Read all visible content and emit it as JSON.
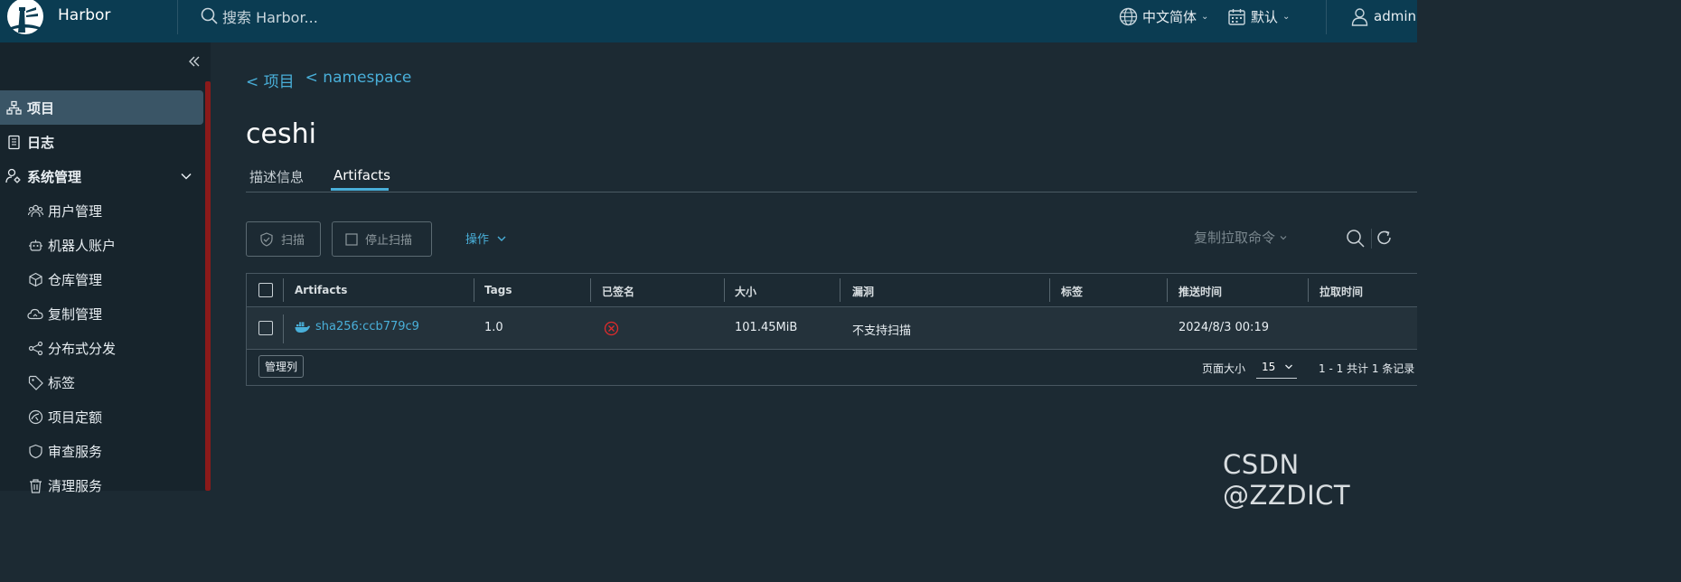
{
  "header": {
    "brand": "Harbor",
    "search_placeholder": "搜索 Harbor...",
    "language": "中文简体",
    "datetime_format": "默认",
    "user": "admin"
  },
  "sidebar": {
    "items": [
      {
        "label": "项目",
        "icon": "projects-icon",
        "active": true
      },
      {
        "label": "日志",
        "icon": "logs-icon"
      },
      {
        "label": "系统管理",
        "icon": "system-admin-icon",
        "expanded": true
      },
      {
        "label": "用户管理",
        "icon": "users-icon"
      },
      {
        "label": "机器人账户",
        "icon": "robot-icon"
      },
      {
        "label": "仓库管理",
        "icon": "registry-icon"
      },
      {
        "label": "复制管理",
        "icon": "replication-icon"
      },
      {
        "label": "分布式分发",
        "icon": "distribution-icon"
      },
      {
        "label": "标签",
        "icon": "tag-icon"
      },
      {
        "label": "项目定额",
        "icon": "quota-icon"
      },
      {
        "label": "审查服务",
        "icon": "shield-icon"
      },
      {
        "label": "清理服务",
        "icon": "trash-icon"
      }
    ]
  },
  "breadcrumb": [
    "< 项目",
    "< namespace"
  ],
  "page_title": "ceshi",
  "tabs": [
    {
      "label": "描述信息"
    },
    {
      "label": "Artifacts",
      "active": true
    }
  ],
  "toolbar": {
    "scan": "扫描",
    "stop_scan": "停止扫描",
    "actions": "操作",
    "copy_pull": "复制拉取命令"
  },
  "table": {
    "columns": [
      "Artifacts",
      "Tags",
      "已签名",
      "大小",
      "漏洞",
      "标签",
      "推送时间",
      "拉取时间"
    ],
    "rows": [
      {
        "artifact": "sha256:ccb779c9",
        "tags": "1.0",
        "signed": "unsigned",
        "size": "101.45MiB",
        "vulnerabilities": "不支持扫描",
        "labels": "",
        "push_time": "2024/8/3 00:19",
        "pull_time": ""
      }
    ],
    "manage_columns": "管理列",
    "page_size_label": "页面大小",
    "page_size": "15",
    "pagination_info": "1 - 1 共计 1 条记录"
  },
  "colors": {
    "header_bg": "#0b3c52",
    "body_bg": "#1c2a33",
    "accent": "#49afd9",
    "danger": "#e02b2b"
  },
  "watermark": "CSDN @ZZDICT"
}
